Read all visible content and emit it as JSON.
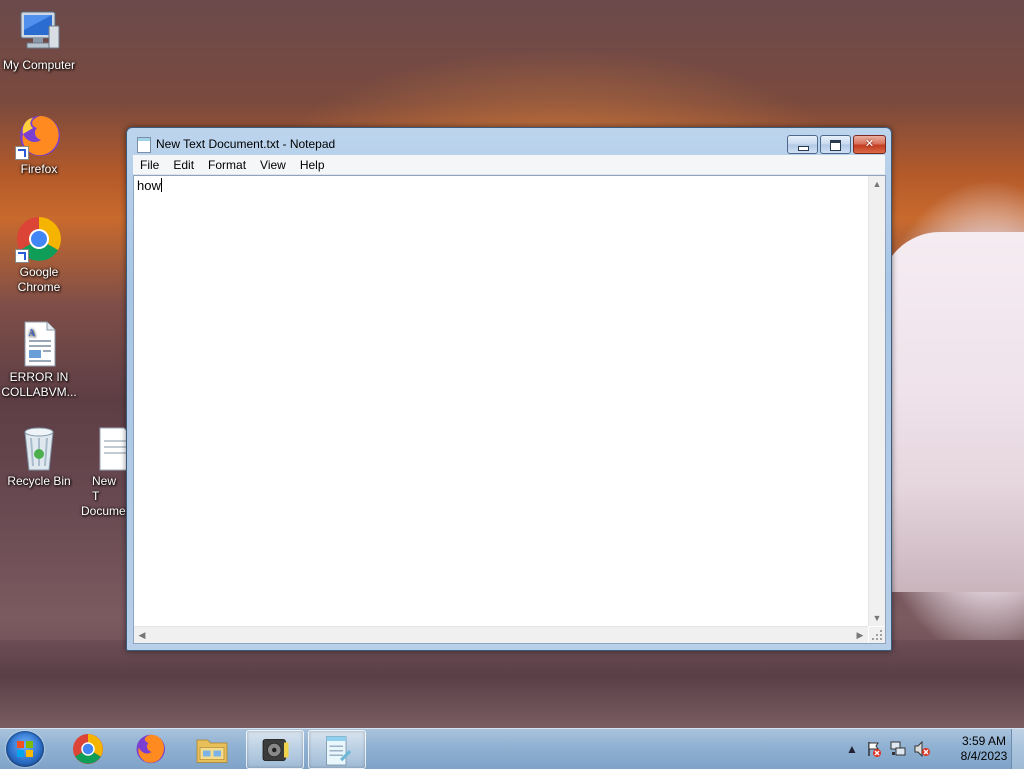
{
  "desktop": {
    "icons": [
      {
        "label_line1": "My Computer",
        "label_line2": "",
        "icon": "computer-icon"
      },
      {
        "label_line1": "Firefox",
        "label_line2": "",
        "icon": "firefox-icon"
      },
      {
        "label_line1": "Google",
        "label_line2": "Chrome",
        "icon": "chrome-icon"
      },
      {
        "label_line1": "ERROR IN",
        "label_line2": "COLLABVM...",
        "icon": "document-icon"
      },
      {
        "label_line1": "Recycle Bin",
        "label_line2": "",
        "icon": "recycle-bin-icon"
      },
      {
        "label_line1": "New T",
        "label_line2": "Docume",
        "icon": "text-file-icon"
      }
    ]
  },
  "window": {
    "title": "New Text Document.txt - Notepad",
    "menu": [
      "File",
      "Edit",
      "Format",
      "View",
      "Help"
    ],
    "content": "how",
    "buttons": {
      "minimize": "minimize-icon",
      "maximize": "maximize-icon",
      "close": "✕"
    }
  },
  "taskbar": {
    "pinned": [
      "chrome-icon",
      "firefox-icon",
      "file-explorer-icon",
      "media-center-icon",
      "notepad-icon"
    ],
    "tray": {
      "time": "3:59 AM",
      "date": "8/4/2023",
      "icons": [
        "show-hidden-icons-icon",
        "action-center-icon",
        "network-icon",
        "volume-muted-icon"
      ]
    }
  },
  "colors": {
    "taskbar": "#8fb1d2",
    "window_frame": "#a9c6e6",
    "close_button": "#c43c22"
  }
}
